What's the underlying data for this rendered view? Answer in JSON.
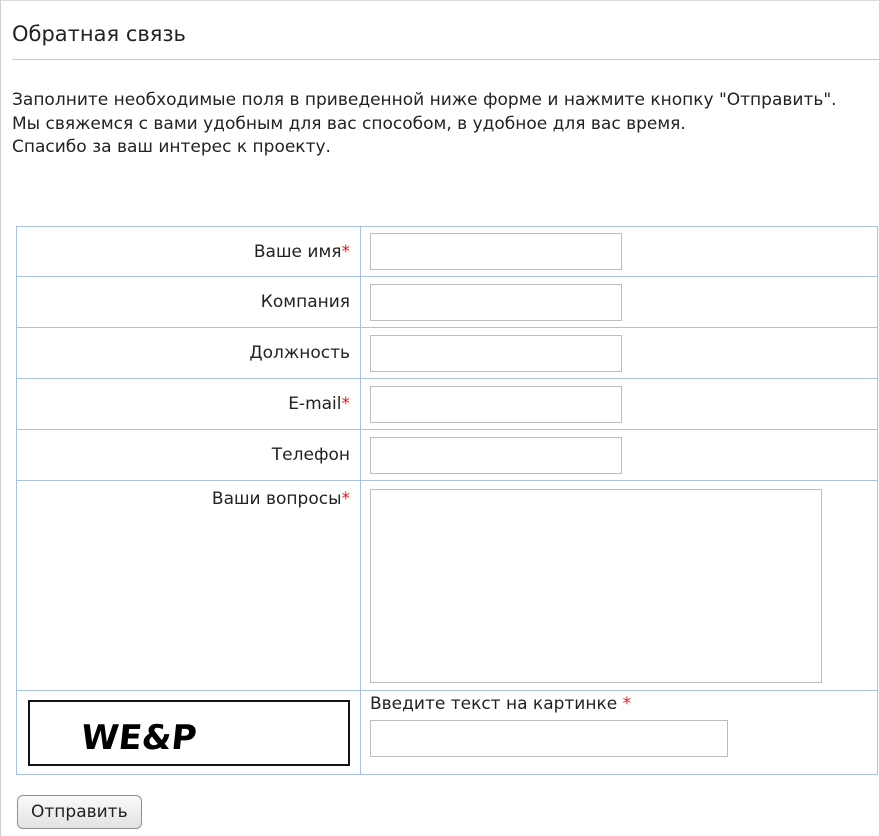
{
  "page": {
    "title": "Обратная связь"
  },
  "intro": {
    "line1": "Заполните необходимые поля в приведенной ниже форме и нажмите кнопку \"Отправить\".",
    "line2": "Мы свяжемся с вами удобным для вас способом, в удобное для вас время.",
    "line3": "Спасибо за ваш интерес к проекту."
  },
  "form": {
    "required_mark": "*",
    "fields": {
      "name": {
        "label": "Ваше имя",
        "value": ""
      },
      "company": {
        "label": "Компания",
        "value": ""
      },
      "position": {
        "label": "Должность",
        "value": ""
      },
      "email": {
        "label": "E-mail",
        "value": ""
      },
      "phone": {
        "label": "Телефон",
        "value": ""
      },
      "questions": {
        "label": "Ваши вопросы",
        "value": ""
      }
    },
    "captcha": {
      "image_text": "WE&P",
      "prompt": "Введите текст на картинке",
      "value": ""
    },
    "submit_label": "Отправить"
  },
  "colors": {
    "table_border": "#a9c3df",
    "required": "#e21b1b"
  }
}
